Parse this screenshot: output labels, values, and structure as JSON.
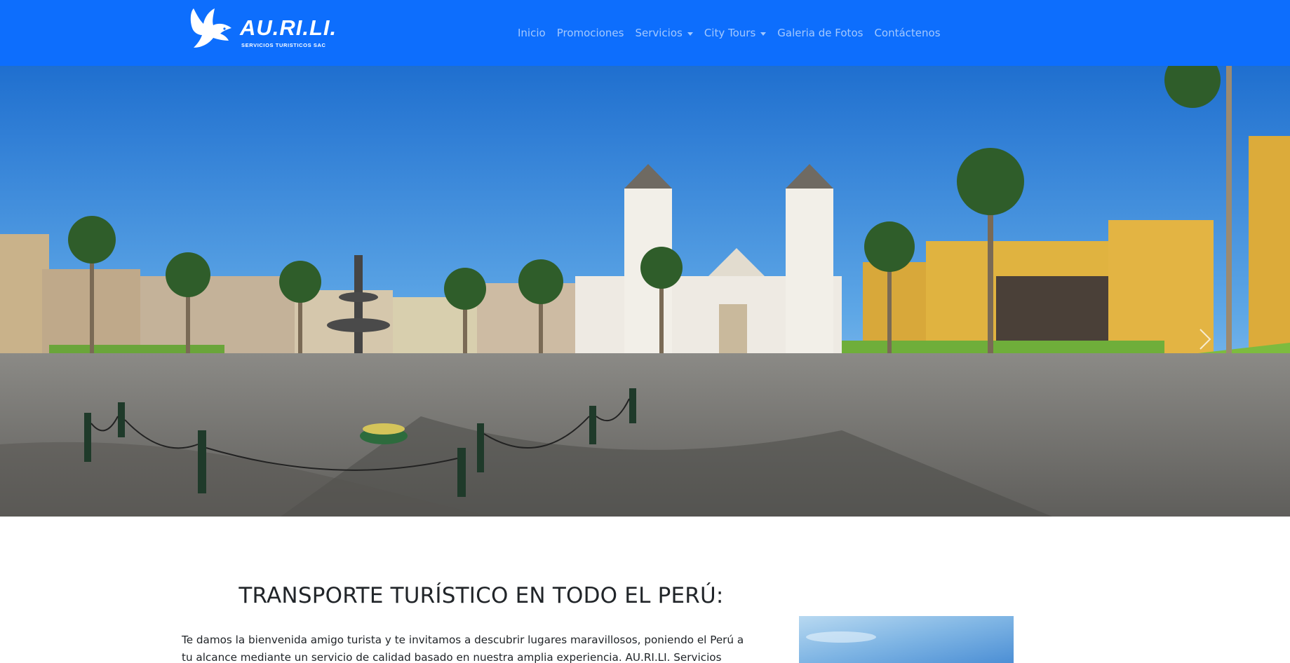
{
  "brand": {
    "name": "AU.RI.LI.",
    "tagline": "SERVICIOS TURISTICOS SAC",
    "logo_icon": "dove-icon"
  },
  "nav": {
    "items": [
      {
        "label": "Inicio",
        "dropdown": false
      },
      {
        "label": "Promociones",
        "dropdown": false
      },
      {
        "label": "Servicios",
        "dropdown": true
      },
      {
        "label": "City Tours",
        "dropdown": true
      },
      {
        "label": "Galeria de Fotos",
        "dropdown": false
      },
      {
        "label": "Contáctenos",
        "dropdown": false
      }
    ]
  },
  "hero": {
    "next_icon": "chevron-right-icon"
  },
  "content": {
    "title": "TRANSPORTE TURÍSTICO EN TODO EL PERÚ:",
    "intro": "Te damos la bienvenida amigo turista y te invitamos a descubrir lugares maravillosos, poniendo el Perú a tu alcance mediante un servicio de calidad basado en nuestra amplia experiencia. AU.RI.LI. Servicios Turísticos se amolda a tus"
  },
  "colors": {
    "navbar": "#0d6efd",
    "nav_text": "rgba(255,255,255,0.62)",
    "text": "#212529"
  }
}
